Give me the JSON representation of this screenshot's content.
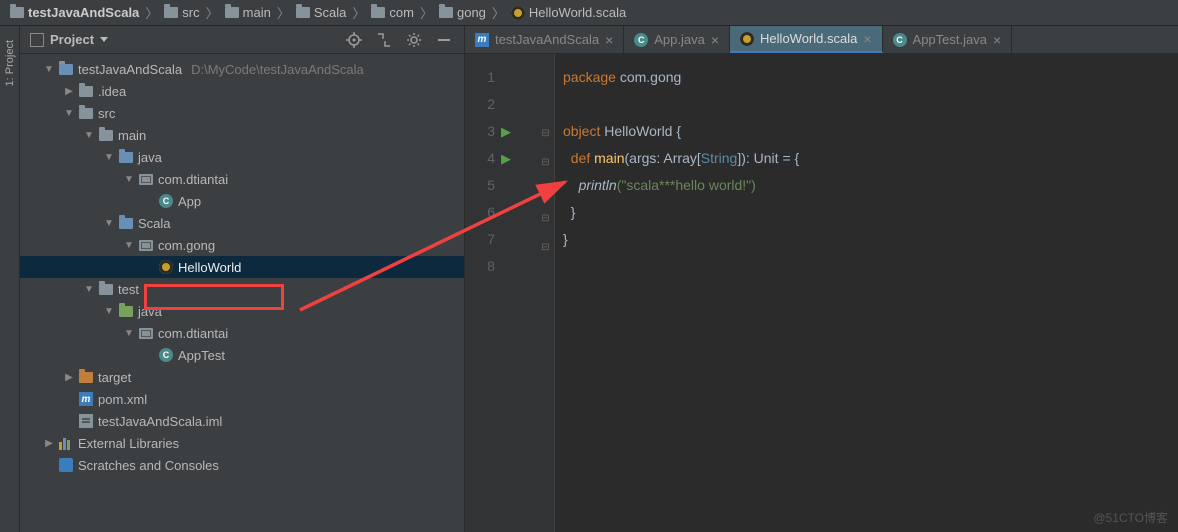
{
  "breadcrumb": [
    {
      "label": "testJavaAndScala",
      "icon": "folder"
    },
    {
      "label": "src",
      "icon": "folder"
    },
    {
      "label": "main",
      "icon": "folder"
    },
    {
      "label": "Scala",
      "icon": "folder"
    },
    {
      "label": "com",
      "icon": "folder"
    },
    {
      "label": "gong",
      "icon": "folder"
    },
    {
      "label": "HelloWorld.scala",
      "icon": "scala-obj"
    }
  ],
  "leftRail": {
    "label": "1: Project"
  },
  "project": {
    "title": "Project",
    "root": {
      "label": "testJavaAndScala",
      "path": "D:\\MyCode\\testJavaAndScala"
    },
    "tree": [
      {
        "depth": 0,
        "chev": "down",
        "icon": "proj",
        "label": "testJavaAndScala",
        "path": "D:\\MyCode\\testJavaAndScala"
      },
      {
        "depth": 1,
        "chev": "right",
        "icon": "folder",
        "label": ".idea"
      },
      {
        "depth": 1,
        "chev": "down",
        "icon": "folder",
        "label": "src"
      },
      {
        "depth": 2,
        "chev": "down",
        "icon": "folder",
        "label": "main"
      },
      {
        "depth": 3,
        "chev": "down",
        "icon": "folder-blue",
        "label": "java"
      },
      {
        "depth": 4,
        "chev": "down",
        "icon": "pkg",
        "label": "com.dtiantai"
      },
      {
        "depth": 5,
        "chev": "",
        "icon": "class",
        "label": "App"
      },
      {
        "depth": 3,
        "chev": "down",
        "icon": "folder-blue",
        "label": "Scala"
      },
      {
        "depth": 4,
        "chev": "down",
        "icon": "pkg",
        "label": "com.gong"
      },
      {
        "depth": 5,
        "chev": "",
        "icon": "scala-obj",
        "label": "HelloWorld",
        "selected": true,
        "highlight": true
      },
      {
        "depth": 2,
        "chev": "down",
        "icon": "folder",
        "label": "test"
      },
      {
        "depth": 3,
        "chev": "down",
        "icon": "folder-green",
        "label": "java"
      },
      {
        "depth": 4,
        "chev": "down",
        "icon": "pkg",
        "label": "com.dtiantai"
      },
      {
        "depth": 5,
        "chev": "",
        "icon": "class",
        "label": "AppTest"
      },
      {
        "depth": 1,
        "chev": "right",
        "icon": "folder-orange",
        "label": "target"
      },
      {
        "depth": 1,
        "chev": "",
        "icon": "maven",
        "label": "pom.xml"
      },
      {
        "depth": 1,
        "chev": "",
        "icon": "iml",
        "label": "testJavaAndScala.iml"
      },
      {
        "depth": 0,
        "chev": "right",
        "icon": "lib",
        "label": "External Libraries"
      },
      {
        "depth": 0,
        "chev": "",
        "icon": "scratch",
        "label": "Scratches and Consoles"
      }
    ]
  },
  "tabs": [
    {
      "label": "testJavaAndScala",
      "icon": "maven"
    },
    {
      "label": "App.java",
      "icon": "class"
    },
    {
      "label": "HelloWorld.scala",
      "icon": "scala-obj",
      "active": true
    },
    {
      "label": "AppTest.java",
      "icon": "class"
    }
  ],
  "code": {
    "lines": [
      "1",
      "2",
      "3",
      "4",
      "5",
      "6",
      "7",
      "8"
    ],
    "runIdx": [
      3,
      4
    ],
    "foldIdx": [
      3,
      4,
      6,
      7
    ],
    "pkg": "package ",
    "pkgName": "com.gong",
    "obj": "object ",
    "objName": "HelloWorld {",
    "def": "def ",
    "main": "main",
    "args": "(args: Array[",
    "str": "String",
    "argsEnd": "]): Unit = {",
    "println": "println",
    "printArg": "(\"scala***hello world!\")",
    "closeBrace": "}"
  },
  "watermark": "@51CTO博客"
}
